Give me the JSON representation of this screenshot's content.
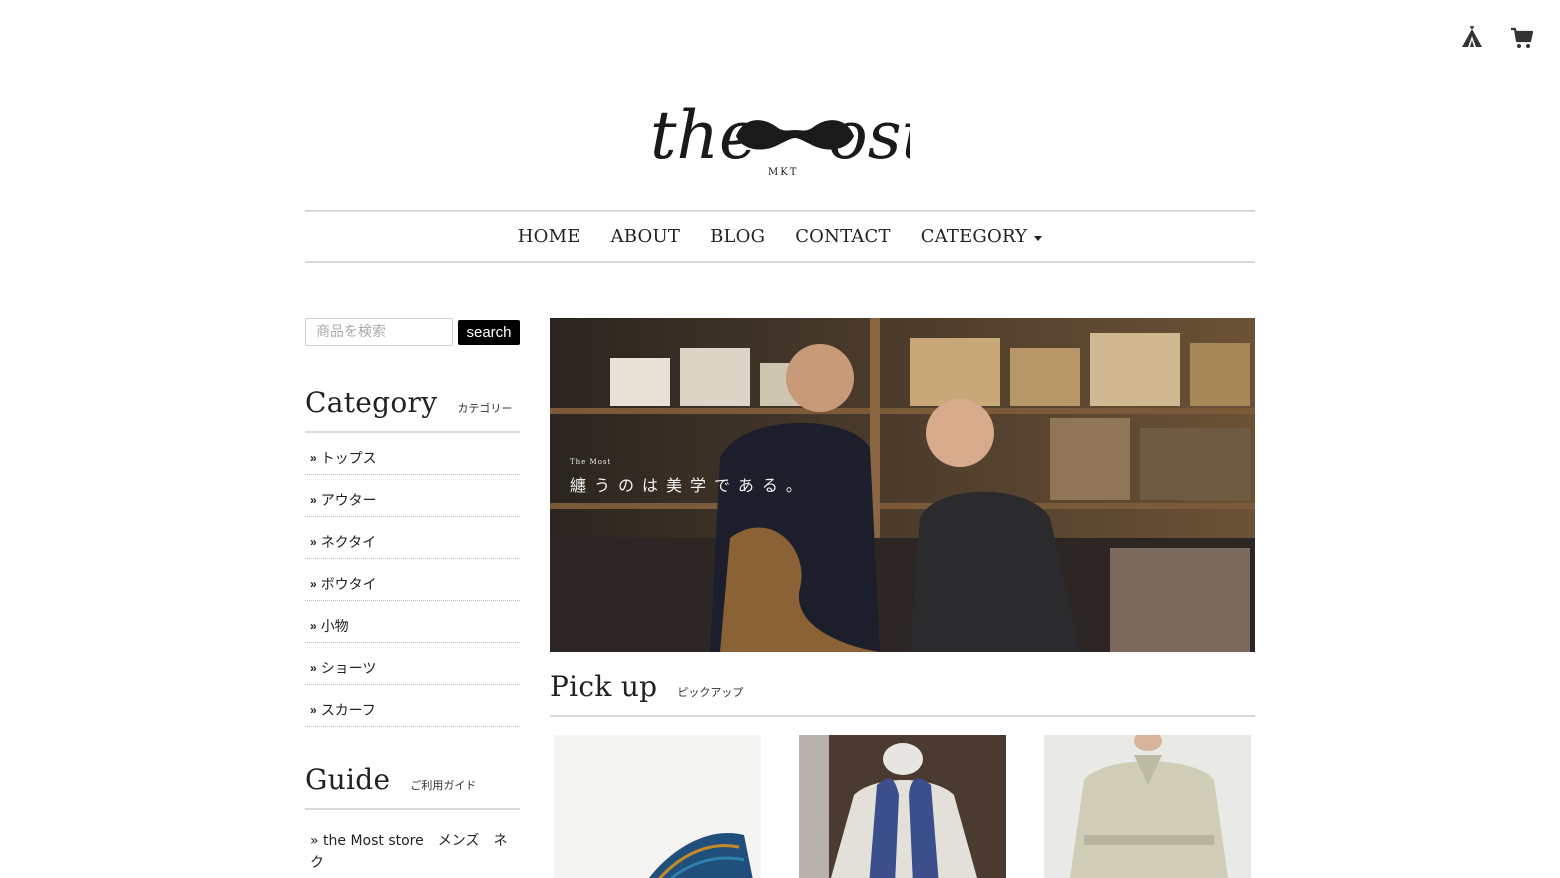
{
  "header": {
    "brand_logo_text": "the Most",
    "brand_logo_sub": "MKT",
    "icons": [
      "tent-icon",
      "cart-icon"
    ]
  },
  "nav": {
    "items": [
      {
        "label": "HOME"
      },
      {
        "label": "ABOUT"
      },
      {
        "label": "BLOG"
      },
      {
        "label": "CONTACT"
      },
      {
        "label": "CATEGORY"
      }
    ]
  },
  "sidebar": {
    "search": {
      "placeholder": "商品を検索",
      "button_label": "search"
    },
    "category": {
      "title": "Category",
      "subtitle": "カテゴリー",
      "items": [
        {
          "label": "トップス"
        },
        {
          "label": "アウター"
        },
        {
          "label": "ネクタイ"
        },
        {
          "label": "ボウタイ"
        },
        {
          "label": "小物"
        },
        {
          "label": "ショーツ"
        },
        {
          "label": "スカーフ"
        }
      ]
    },
    "guide": {
      "title": "Guide",
      "subtitle": "ご利用ガイド",
      "text": "» the Most store　メンズ　ネク"
    }
  },
  "hero": {
    "brand_small": "The Most",
    "tagline": "纏うのは美学である。"
  },
  "pickup": {
    "title": "Pick up",
    "subtitle": "ピックアップ"
  },
  "colors": {
    "accent": "#000000",
    "divider": "#d9d9d9",
    "text": "#222222"
  }
}
